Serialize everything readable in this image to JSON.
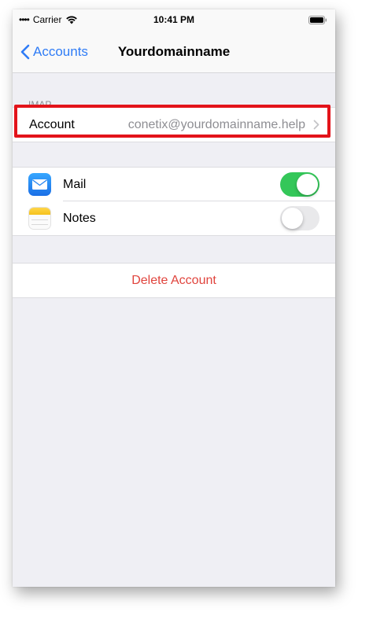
{
  "status_bar": {
    "carrier": "Carrier",
    "time": "10:41 PM"
  },
  "nav": {
    "back_label": "Accounts",
    "title": "Yourdomainname"
  },
  "imap_section": {
    "header": "IMAP",
    "account_label": "Account",
    "account_value": "conetix@yourdomainname.help"
  },
  "apps": [
    {
      "label": "Mail",
      "icon": "mail-icon",
      "enabled": true
    },
    {
      "label": "Notes",
      "icon": "notes-icon",
      "enabled": false
    }
  ],
  "actions": {
    "delete_label": "Delete Account"
  },
  "colors": {
    "accent": "#2f7cf6",
    "toggle_on": "#34c759",
    "destructive": "#e0443d",
    "highlight": "#e3131a"
  }
}
